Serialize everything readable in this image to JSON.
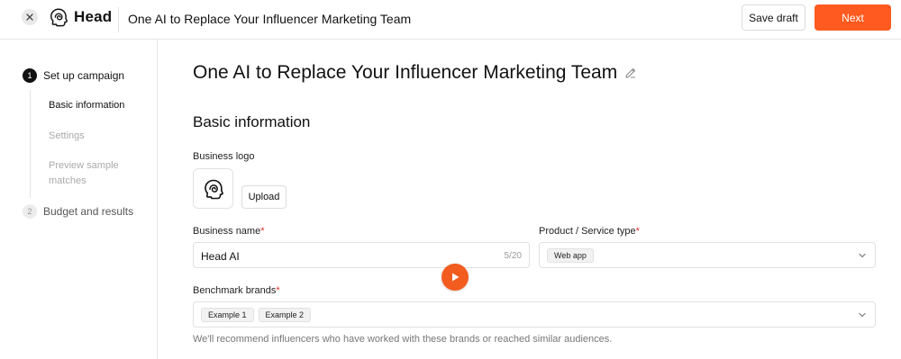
{
  "header": {
    "logo_text": "Head",
    "title": "One AI to Replace Your Influencer Marketing Team",
    "save_label": "Save draft",
    "next_label": "Next",
    "accent": "#ff5a1f"
  },
  "sidebar": {
    "steps": [
      {
        "num": "1",
        "label": "Set up campaign",
        "active": true
      },
      {
        "num": "2",
        "label": "Budget and results",
        "active": false
      }
    ],
    "sub_items": [
      {
        "label": "Basic information",
        "active": true
      },
      {
        "label": "Settings",
        "active": false
      },
      {
        "label": "Preview sample matches",
        "active": false
      }
    ]
  },
  "main": {
    "title": "One AI to Replace Your Influencer Marketing Team",
    "section_title": "Basic information",
    "business_logo_label": "Business logo",
    "upload_label": "Upload",
    "business_name_label": "Business name",
    "business_name_value": "Head AI",
    "business_name_counter": "5/20",
    "product_type_label": "Product / Service type",
    "product_type_tag": "Web app",
    "benchmark_label": "Benchmark brands",
    "benchmark_tags": [
      "Example 1",
      "Example 2"
    ],
    "helper_text": "We'll recommend influencers who have worked with these brands or reached similar audiences.",
    "required_mark": "*"
  },
  "icons": [
    "close-icon",
    "head-logo-icon",
    "edit-icon",
    "chevron-down-icon",
    "play-icon"
  ]
}
